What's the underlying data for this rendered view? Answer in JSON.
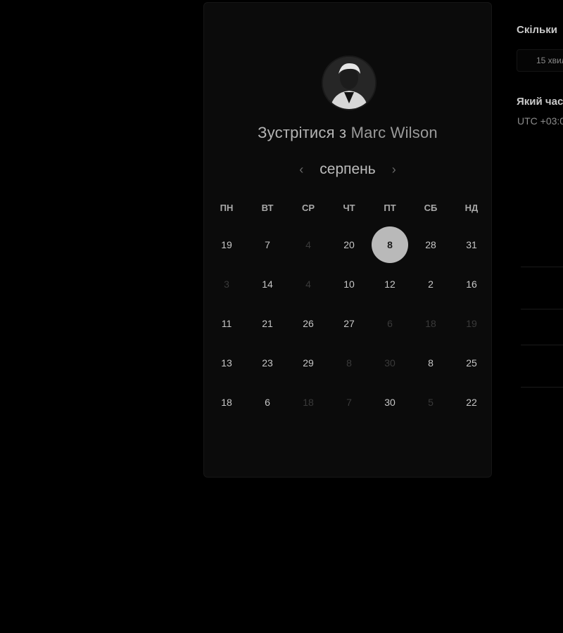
{
  "booking": {
    "title_prefix": "Зустрітися з",
    "host_name": "Marc Wilson",
    "month": "серпень",
    "weekdays": [
      "ПН",
      "ВТ",
      "СР",
      "ЧТ",
      "ПТ",
      "СБ",
      "НД"
    ],
    "days": [
      {
        "label": "19",
        "state": "active"
      },
      {
        "label": "7",
        "state": "active"
      },
      {
        "label": "4",
        "state": "disabled"
      },
      {
        "label": "20",
        "state": "active"
      },
      {
        "label": "8",
        "state": "selected"
      },
      {
        "label": "28",
        "state": "active"
      },
      {
        "label": "31",
        "state": "active"
      },
      {
        "label": "3",
        "state": "disabled"
      },
      {
        "label": "14",
        "state": "active"
      },
      {
        "label": "4",
        "state": "disabled"
      },
      {
        "label": "10",
        "state": "active"
      },
      {
        "label": "12",
        "state": "active"
      },
      {
        "label": "2",
        "state": "active"
      },
      {
        "label": "16",
        "state": "active"
      },
      {
        "label": "11",
        "state": "active"
      },
      {
        "label": "21",
        "state": "active"
      },
      {
        "label": "26",
        "state": "active"
      },
      {
        "label": "27",
        "state": "active"
      },
      {
        "label": "6",
        "state": "disabled"
      },
      {
        "label": "18",
        "state": "disabled"
      },
      {
        "label": "19",
        "state": "disabled"
      },
      {
        "label": "13",
        "state": "active"
      },
      {
        "label": "23",
        "state": "active"
      },
      {
        "label": "29",
        "state": "active"
      },
      {
        "label": "8",
        "state": "disabled"
      },
      {
        "label": "30",
        "state": "disabled"
      },
      {
        "label": "8",
        "state": "active"
      },
      {
        "label": "25",
        "state": "active"
      },
      {
        "label": "18",
        "state": "active"
      },
      {
        "label": "6",
        "state": "active"
      },
      {
        "label": "18",
        "state": "disabled"
      },
      {
        "label": "7",
        "state": "disabled"
      },
      {
        "label": "30",
        "state": "active"
      },
      {
        "label": "5",
        "state": "disabled"
      },
      {
        "label": "22",
        "state": "active"
      }
    ],
    "icons": {
      "prev": "chevron-left-icon",
      "next": "chevron-right-icon"
    }
  },
  "side_panel": {
    "duration_heading": "Скільки",
    "duration_value": "15 хвил",
    "time_heading": "Який час",
    "timezone": "UTC +03:0"
  },
  "colors": {
    "background": "#000000",
    "card": "#0b0b0b",
    "selected_day": "#b9b9b9"
  }
}
